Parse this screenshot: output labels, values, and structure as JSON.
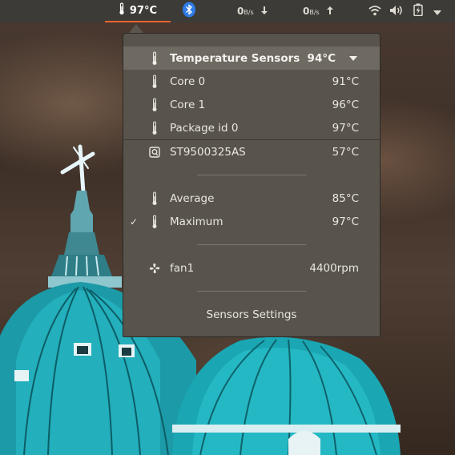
{
  "panel": {
    "temperature": "97°C",
    "net_down": {
      "value": "0",
      "unit": "B/s"
    },
    "net_up": {
      "value": "0",
      "unit": "B/s"
    },
    "icons": [
      "thermometer-icon",
      "bluetooth-icon",
      "arrow-down-icon",
      "arrow-up-icon",
      "wifi-icon",
      "volume-icon",
      "battery-charging-icon",
      "chevron-down-icon"
    ],
    "accent": "#e9632d"
  },
  "menu": {
    "header": {
      "label": "Temperature Sensors",
      "value": "94°C"
    },
    "sensors": [
      {
        "label": "Core 0",
        "value": "91°C",
        "icon": "thermometer-icon"
      },
      {
        "label": "Core 1",
        "value": "96°C",
        "icon": "thermometer-icon"
      },
      {
        "label": "Package id 0",
        "value": "97°C",
        "icon": "thermometer-icon"
      }
    ],
    "disk": {
      "label": "ST9500325AS",
      "value": "57°C",
      "icon": "harddisk-icon"
    },
    "summary": [
      {
        "label": "Average",
        "value": "85°C",
        "checked": false
      },
      {
        "label": "Maximum",
        "value": "97°C",
        "checked": true
      }
    ],
    "check_mark": "✓",
    "fan": {
      "label": "fan1",
      "value": "4400rpm",
      "icon": "fan-icon"
    },
    "settings_label": "Sensors Settings"
  }
}
